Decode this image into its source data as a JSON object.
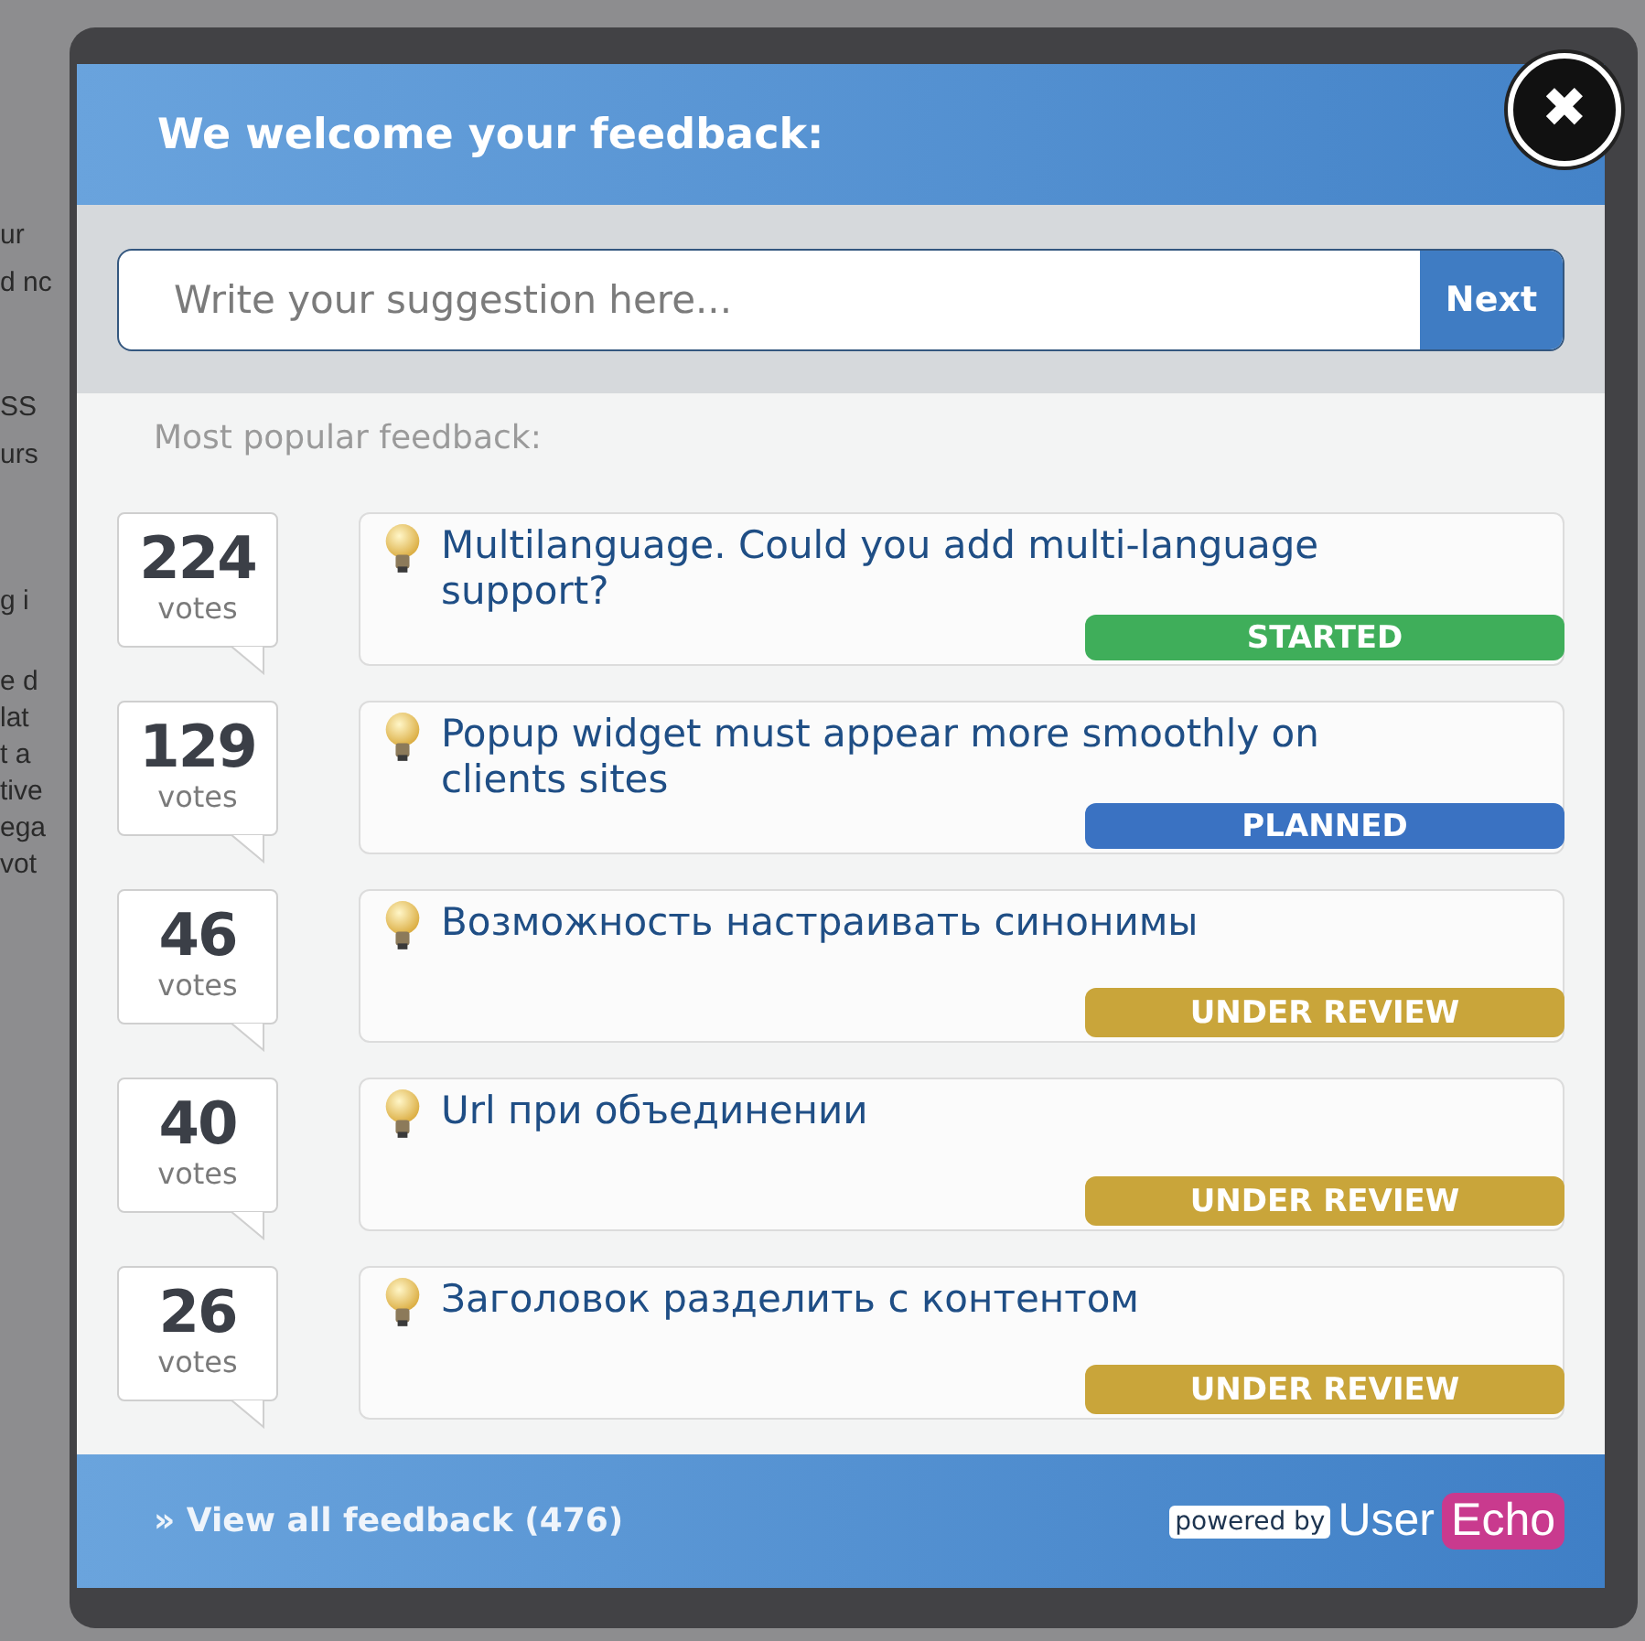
{
  "background_text": [
    "ur",
    "d nc",
    "SS",
    "urs",
    "g i",
    "e d",
    "lat",
    "t a",
    "tive",
    "ega",
    "vot"
  ],
  "widget": {
    "title": "We welcome your feedback:",
    "close_button": {
      "label": "✖"
    },
    "suggestion": {
      "placeholder": "Write your suggestion here...",
      "button": "Next"
    },
    "list_heading": "Most popular feedback:",
    "items": [
      {
        "votes": "224",
        "votes_label": "votes",
        "title": "Multilanguage. Could you add multi-language support?",
        "status": "STARTED",
        "color": "#3fae5a"
      },
      {
        "votes": "129",
        "votes_label": "votes",
        "title": "Popup widget must appear more smoothly on clients sites",
        "status": "PLANNED",
        "color": "#3a72c2"
      },
      {
        "votes": "46",
        "votes_label": "votes",
        "title": "Возможность настраивать синонимы",
        "status": "UNDER REVIEW",
        "color": "#c9a53a"
      },
      {
        "votes": "40",
        "votes_label": "votes",
        "title": "Url при объединении",
        "status": "UNDER REVIEW",
        "color": "#c9a53a"
      },
      {
        "votes": "26",
        "votes_label": "votes",
        "title": "Заголовок разделить с контентом",
        "status": "UNDER REVIEW",
        "color": "#c9a53a"
      }
    ],
    "footer": {
      "link": "» View all feedback (476)",
      "powered_by": "powered by",
      "brand_first": "User",
      "brand_second": "Echo"
    }
  }
}
